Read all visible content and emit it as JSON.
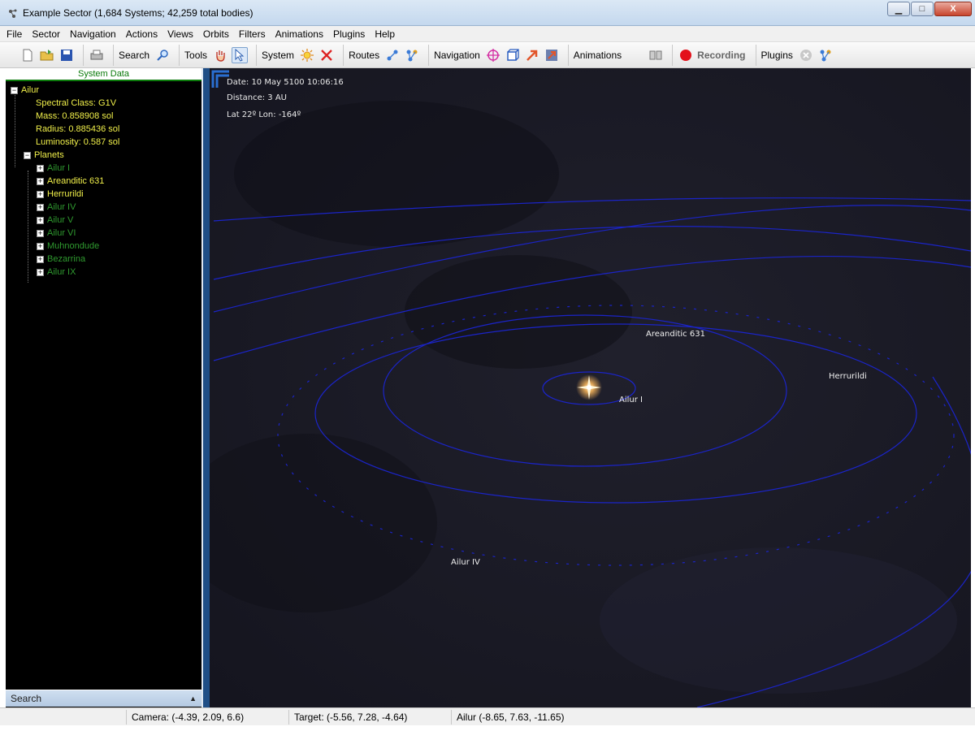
{
  "window": {
    "title": "Example Sector (1,684 Systems; 42,259 total bodies)",
    "minimize_glyph": "▁",
    "maximize_glyph": "□",
    "close_glyph": "X"
  },
  "menu": [
    "File",
    "Sector",
    "Navigation",
    "Actions",
    "Views",
    "Orbits",
    "Filters",
    "Animations",
    "Plugins",
    "Help"
  ],
  "toolbar": {
    "search_label": "Search",
    "tools_label": "Tools",
    "system_label": "System",
    "routes_label": "Routes",
    "navigation_label": "Navigation",
    "animations_label": "Animations",
    "recording_label": "Recording",
    "plugins_label": "Plugins"
  },
  "panel": {
    "title": "System Data",
    "star_name": "Ailur",
    "properties": [
      "Spectral Class: G1V",
      "Mass: 0.858908 sol",
      "Radius: 0.885436 sol",
      "Luminosity: 0.587 sol"
    ],
    "planets_label": "Planets",
    "planets": [
      {
        "name": "Ailur I",
        "color": "#2f9a2f"
      },
      {
        "name": "Areanditic 631",
        "color": "#f0ef4a"
      },
      {
        "name": "Herrurildi",
        "color": "#f0ef4a"
      },
      {
        "name": "Ailur IV",
        "color": "#2f9a2f"
      },
      {
        "name": "Ailur V",
        "color": "#2f9a2f"
      },
      {
        "name": "Ailur VI",
        "color": "#2f9a2f"
      },
      {
        "name": "Muhnondude",
        "color": "#2f9a2f"
      },
      {
        "name": "Bezarrina",
        "color": "#2f9a2f"
      },
      {
        "name": "Ailur IX",
        "color": "#2f9a2f"
      }
    ],
    "expand_glyph": "+",
    "collapse_glyph": "−",
    "search_label": "Search",
    "search_arrow": "▲"
  },
  "hud": {
    "date": "Date: 10 May 5100 10:06:16",
    "distance": "Distance: 3 AU",
    "latlon": "Lat 22º Lon: -164º"
  },
  "view_labels": {
    "areanditic": "Areanditic 631",
    "herrurildi": "Herrurildi",
    "ailur_i": "Ailur I",
    "ailur_iv": "Ailur IV"
  },
  "colors": {
    "orbit": "#1b24c8",
    "space": "#1a1a26",
    "star": "#fff6d8"
  },
  "status": {
    "camera": "Camera: (-4.39, 2.09, 6.6)",
    "target": "Target: (-5.56, 7.28, -4.64)",
    "ailur": "Ailur (-8.65, 7.63, -11.65)"
  }
}
